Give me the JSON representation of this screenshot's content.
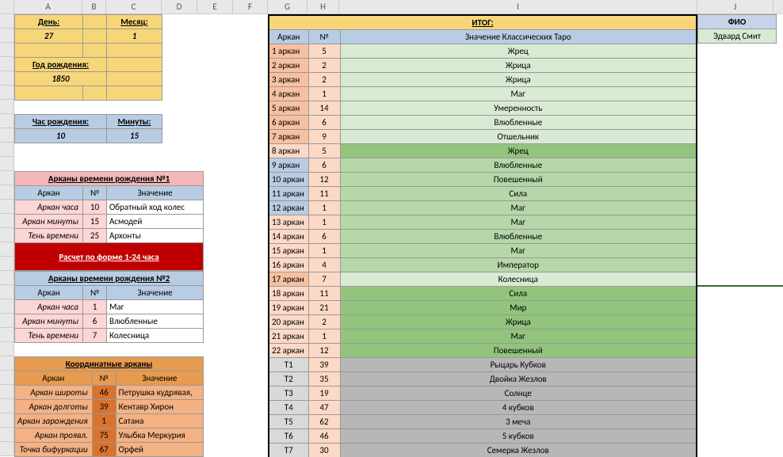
{
  "cols": {
    "A": 86,
    "B": 30,
    "C": 70,
    "gap1": 195,
    "G": 50,
    "H": 40,
    "I": 410,
    "J": 96
  },
  "top": {
    "day_label": "День:",
    "day": "27",
    "month_label": "Месяц:",
    "month": "1",
    "year_label": "Год рождения:",
    "year": "1850",
    "hour_label": "Час рождения:",
    "hour": "10",
    "min_label": "Минуты:",
    "min": "15"
  },
  "time1": {
    "title": "Арканы времени рождения №1",
    "cols": [
      "Аркан",
      "№",
      "Значение"
    ],
    "rows": [
      [
        "Аркан часа",
        "10",
        "Обратный ход колес"
      ],
      [
        "Аркан минуты",
        "15",
        "Асмодей"
      ],
      [
        "Тень времени",
        "25",
        "Архонты"
      ]
    ]
  },
  "calc_btn": "Расчет по форме 1-24 часа",
  "time2": {
    "title": "Арканы времени рождения №2",
    "cols": [
      "Аркан",
      "№",
      "Значение"
    ],
    "rows": [
      [
        "Аркан часа",
        "1",
        "Маг"
      ],
      [
        "Аркан минуты",
        "6",
        "Влюбленные"
      ],
      [
        "Тень времени",
        "7",
        "Колесница"
      ]
    ]
  },
  "coord": {
    "title": "Координатные арканы",
    "cols": [
      "Аркан",
      "№",
      "Значение"
    ],
    "rows": [
      [
        "Аркан широты",
        "46",
        "Петрушка кудрявая,"
      ],
      [
        "Аркан долготы",
        "39",
        "Кентавр Хирон"
      ],
      [
        "Аркан зарождения",
        "1",
        "Сатана"
      ],
      [
        "Аркан проявл.",
        "75",
        "Улыбка Меркурия"
      ],
      [
        "Точка бифуркации",
        "67",
        "Орфей"
      ]
    ]
  },
  "result": {
    "title": "ИТОГ:",
    "cols": [
      "Аркан",
      "№",
      "Значение Классических Таро"
    ],
    "rows": [
      {
        "g": 1,
        "a": "1 аркан",
        "n": "5",
        "v": "Жрец",
        "s": 1
      },
      {
        "g": 1,
        "a": "2 аркан",
        "n": "2",
        "v": "Жрица",
        "s": 1
      },
      {
        "g": 1,
        "a": "3 аркан",
        "n": "2",
        "v": "Жрица",
        "s": 1
      },
      {
        "g": 1,
        "a": "4 аркан",
        "n": "1",
        "v": "Маг",
        "s": 1
      },
      {
        "g": 1,
        "a": "5 аркан",
        "n": "14",
        "v": "Умеренность",
        "s": 1
      },
      {
        "g": 1,
        "a": "6 аркан",
        "n": "6",
        "v": "Влюбленные",
        "s": 1
      },
      {
        "g": 1,
        "a": "7 аркан",
        "n": "9",
        "v": "Отшельник",
        "s": 1
      },
      {
        "g": 2,
        "a": "8 аркан",
        "n": "5",
        "v": "Жрец",
        "s": 3
      },
      {
        "g": 3,
        "a": "9 аркан",
        "n": "6",
        "v": "Влюбленные",
        "s": 2
      },
      {
        "g": 3,
        "a": "10 аркан",
        "n": "12",
        "v": "Повешенный",
        "s": 2
      },
      {
        "g": 3,
        "a": "11 аркан",
        "n": "11",
        "v": "Сила",
        "s": 2
      },
      {
        "g": 3,
        "a": "12 аркан",
        "n": "1",
        "v": "Маг",
        "s": 2
      },
      {
        "g": 2,
        "a": "13 аркан",
        "n": "1",
        "v": "Маг",
        "s": 2
      },
      {
        "g": 2,
        "a": "14 аркан",
        "n": "6",
        "v": "Влюбленные",
        "s": 2
      },
      {
        "g": 2,
        "a": "15 аркан",
        "n": "1",
        "v": "Маг",
        "s": 2
      },
      {
        "g": 2,
        "a": "16 аркан",
        "n": "4",
        "v": "Император",
        "s": 2
      },
      {
        "g": 1,
        "a": "17 аркан",
        "n": "7",
        "v": "Колесница",
        "s": 1
      },
      {
        "g": 2,
        "a": "18 аркан",
        "n": "11",
        "v": "Сила",
        "s": 3
      },
      {
        "g": 2,
        "a": "19 аркан",
        "n": "21",
        "v": "Мир",
        "s": 3
      },
      {
        "g": 2,
        "a": "20 аркан",
        "n": "2",
        "v": "Жрица",
        "s": 3
      },
      {
        "g": 2,
        "a": "21 аркан",
        "n": "1",
        "v": "Маг",
        "s": 3
      },
      {
        "g": 2,
        "a": "22 аркан",
        "n": "12",
        "v": "Повешенный",
        "s": 3
      },
      {
        "g": "t",
        "a": "Т1",
        "n": "39",
        "v": "Рыцарь Кубков",
        "s": "g"
      },
      {
        "g": "t",
        "a": "Т2",
        "n": "35",
        "v": "Двойка Жезлов",
        "s": "g"
      },
      {
        "g": "t",
        "a": "Т3",
        "n": "19",
        "v": "Солнце",
        "s": "g"
      },
      {
        "g": "t",
        "a": "Т4",
        "n": "47",
        "v": "4 кубков",
        "s": "g"
      },
      {
        "g": "t",
        "a": "Т5",
        "n": "62",
        "v": "3 меча",
        "s": "g"
      },
      {
        "g": "t",
        "a": "Т6",
        "n": "46",
        "v": "5 кубков",
        "s": "g"
      },
      {
        "g": "t",
        "a": "Т7",
        "n": "30",
        "v": "Семерка Жезлов",
        "s": "g"
      }
    ]
  },
  "fio": {
    "label": "ФИО",
    "value": "Эдвард Смит"
  },
  "col_letters": [
    "A",
    "B",
    "C",
    "D",
    "E",
    "F",
    "G",
    "H",
    "I",
    "J"
  ]
}
